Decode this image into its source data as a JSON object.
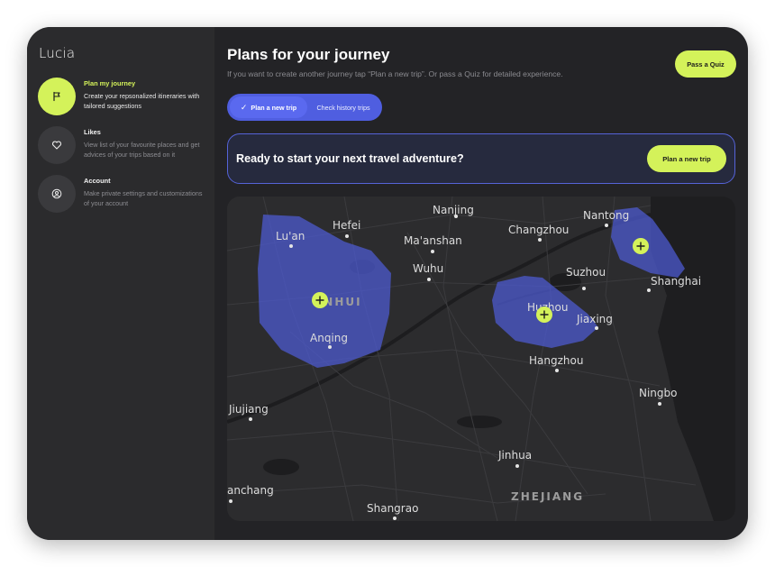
{
  "app": {
    "name": "Lucia"
  },
  "sidebar": {
    "items": [
      {
        "title": "Plan my journey",
        "description": "Create your repsonalized itineraries with tailored suggestions",
        "icon": "flag-icon",
        "active": true
      },
      {
        "title": "Likes",
        "description": "View list of your favourite places and get advices of your trips based on it",
        "icon": "heart-icon",
        "active": false
      },
      {
        "title": "Account",
        "description": "Make private settings and customizations of your account",
        "icon": "user-icon",
        "active": false
      }
    ]
  },
  "header": {
    "title": "Plans for your journey",
    "subtitle": "If you want to create another journey tap “Plan a new trip”. Or pass a Quiz for detailed experience.",
    "quiz_button": "Pass a Quiz"
  },
  "segmented": {
    "options": [
      {
        "label": "Plan a new trip",
        "selected": true
      },
      {
        "label": "Check history trips",
        "selected": false
      }
    ]
  },
  "banner": {
    "text": "Ready to start your next travel adventure?",
    "button": "Plan a new trip"
  },
  "map": {
    "cities": [
      "Nanjing",
      "Hefei",
      "Lu'an",
      "Ma'anshan",
      "Changzhou",
      "Nantong",
      "Wuhu",
      "Suzhou",
      "Shanghai",
      "Huzhou",
      "Jiaxing",
      "Anqing",
      "Hangzhou",
      "Ningbo",
      "Jiujiang",
      "Jinhua",
      "anchang",
      "Shangrao"
    ],
    "regions": [
      "ANHUI",
      "ZHEJIANG"
    ],
    "markers": 3
  },
  "colors": {
    "accent": "#d4f25a",
    "primary": "#4f5ee0",
    "background": "#232326",
    "sidebar": "#2b2b2d"
  }
}
